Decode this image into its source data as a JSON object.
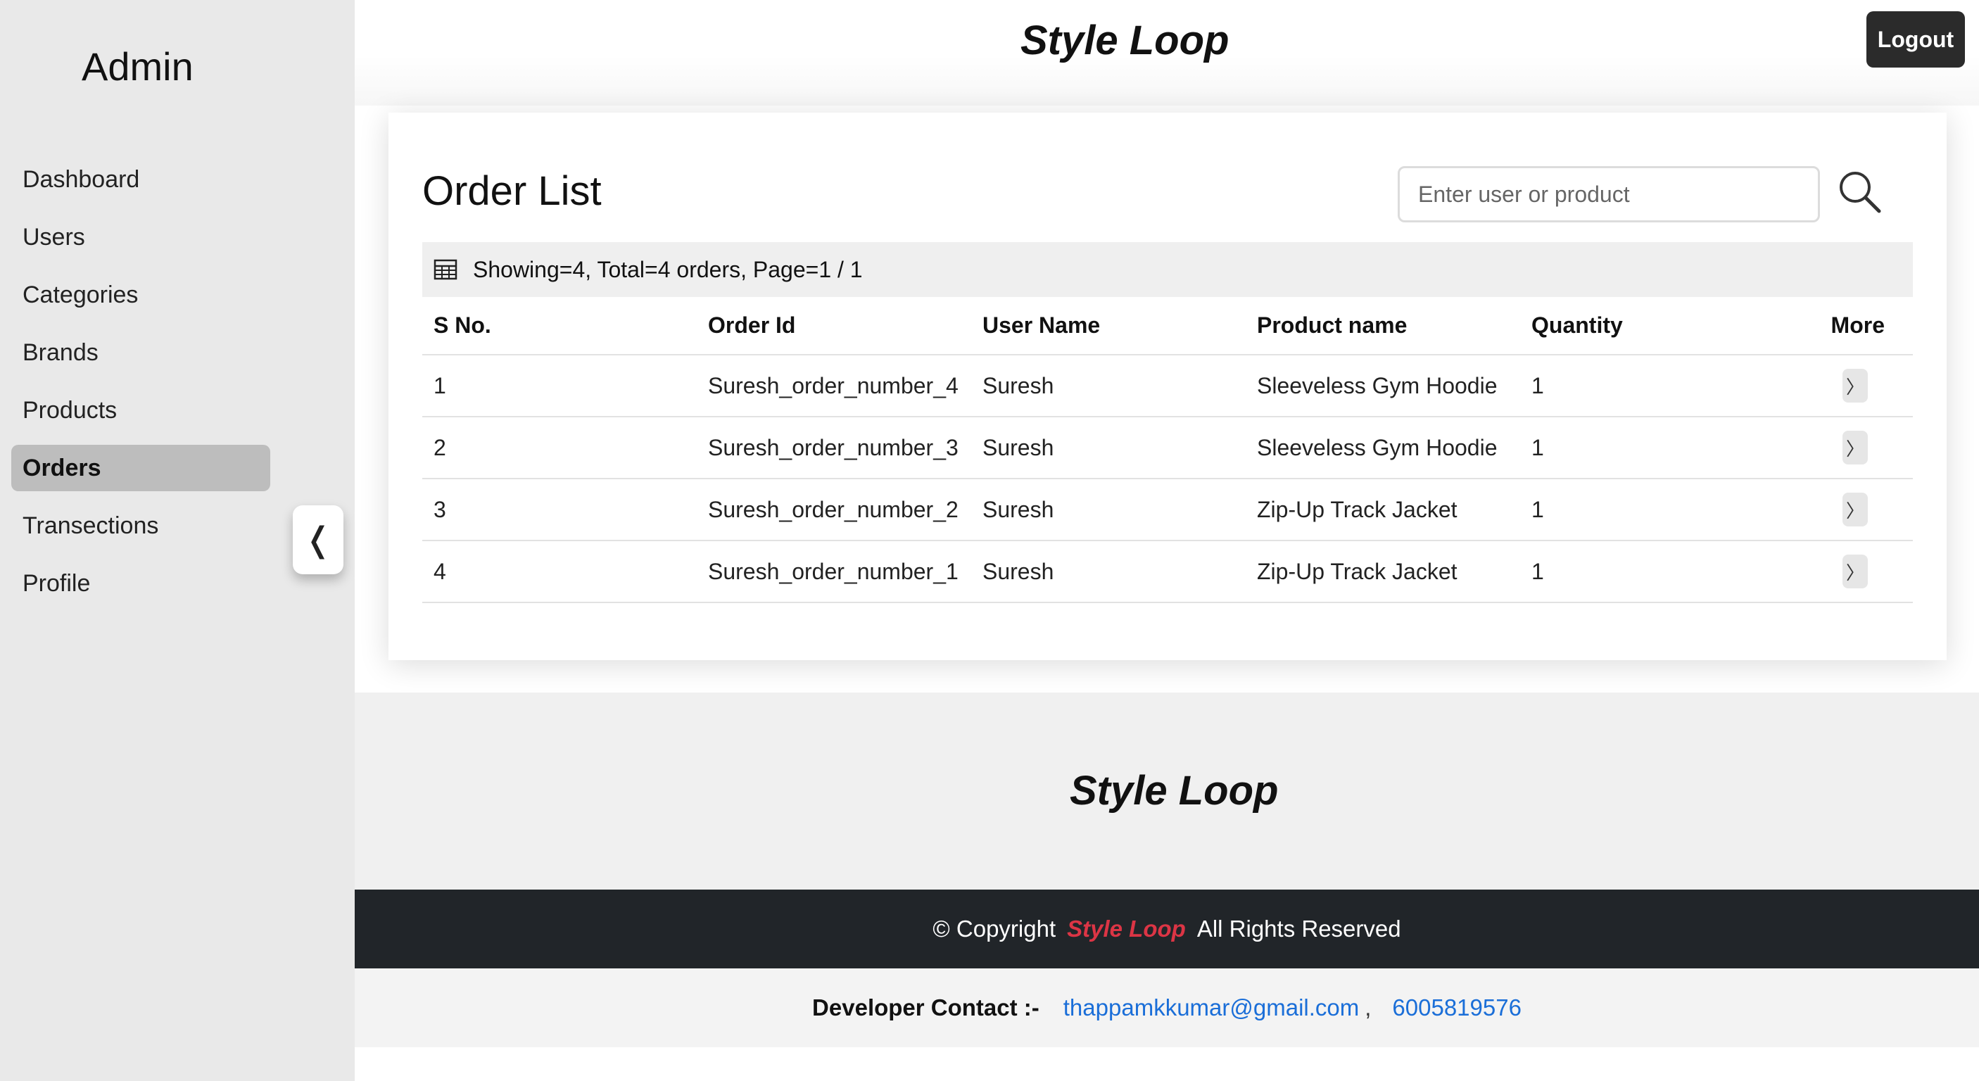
{
  "sidebar": {
    "title": "Admin",
    "items": [
      {
        "label": "Dashboard",
        "active": false
      },
      {
        "label": "Users",
        "active": false
      },
      {
        "label": "Categories",
        "active": false
      },
      {
        "label": "Brands",
        "active": false
      },
      {
        "label": "Products",
        "active": false
      },
      {
        "label": "Orders",
        "active": true
      },
      {
        "label": "Transections",
        "active": false
      },
      {
        "label": "Profile",
        "active": false
      }
    ],
    "collapse_icon": "chevron-left-icon",
    "collapse_glyph": "❬"
  },
  "header": {
    "brand": "Style Loop",
    "logout_label": "Logout"
  },
  "orders": {
    "title": "Order List",
    "search": {
      "placeholder": "Enter user or product",
      "value": "",
      "icon": "search-icon"
    },
    "summary": "Showing=4, Total=4 orders, Page=1 / 1",
    "summary_icon": "table-icon",
    "columns": [
      "S No.",
      "Order Id",
      "User Name",
      "Product name",
      "Quantity",
      "More"
    ],
    "rows": [
      {
        "sno": "1",
        "order_id": "Suresh_order_number_4",
        "user": "Suresh",
        "product": "Sleeveless Gym Hoodie",
        "qty": "1",
        "more": "〉"
      },
      {
        "sno": "2",
        "order_id": "Suresh_order_number_3",
        "user": "Suresh",
        "product": "Sleeveless Gym Hoodie",
        "qty": "1",
        "more": "〉"
      },
      {
        "sno": "3",
        "order_id": "Suresh_order_number_2",
        "user": "Suresh",
        "product": "Zip-Up Track Jacket",
        "qty": "1",
        "more": "〉"
      },
      {
        "sno": "4",
        "order_id": "Suresh_order_number_1",
        "user": "Suresh",
        "product": "Zip-Up Track Jacket",
        "qty": "1",
        "more": "〉"
      }
    ]
  },
  "footer": {
    "brand": "Style Loop",
    "copyright_prefix": "© Copyright",
    "copyright_brand": "Style Loop",
    "copyright_suffix": "All Rights Reserved",
    "contact_label": "Developer Contact :-",
    "email": "thappamkkumar@gmail.com",
    "separator": ",",
    "phone": "6005819576"
  },
  "colors": {
    "sidebar_bg": "#e9e9e9",
    "active_item_bg": "#bdbdbd",
    "logout_bg": "#2b2b2b",
    "copyright_bg": "#212529",
    "brand_red": "#dc3545",
    "link_blue": "#1a6ed8"
  }
}
